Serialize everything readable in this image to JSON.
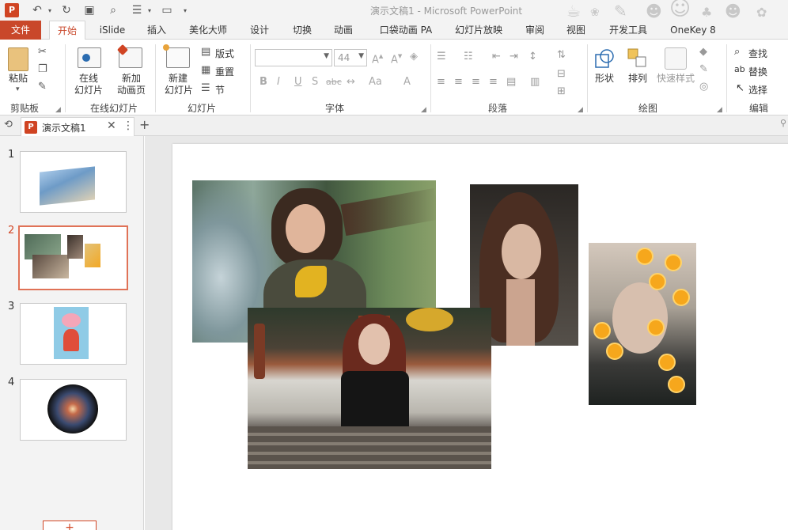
{
  "app": {
    "title": "演示文稿1 - Microsoft PowerPoint",
    "logo_letter": "P"
  },
  "tabs": [
    {
      "label": "文件"
    },
    {
      "label": "开始"
    },
    {
      "label": "iSlide"
    },
    {
      "label": "插入"
    },
    {
      "label": "美化大师"
    },
    {
      "label": "设计"
    },
    {
      "label": "切换"
    },
    {
      "label": "动画"
    },
    {
      "label": "口袋动画 PA"
    },
    {
      "label": "幻灯片放映"
    },
    {
      "label": "审阅"
    },
    {
      "label": "视图"
    },
    {
      "label": "开发工具"
    },
    {
      "label": "OneKey 8"
    }
  ],
  "ribbon": {
    "clipboard": {
      "label": "剪贴板",
      "paste": "粘贴"
    },
    "online_slides": {
      "label": "在线幻灯片",
      "btn1_line1": "在线",
      "btn1_line2": "幻灯片",
      "btn2_line1": "新加",
      "btn2_line2": "动画页"
    },
    "slides": {
      "label": "幻灯片",
      "new_line1": "新建",
      "new_line2": "幻灯片",
      "layout": "版式",
      "reset": "重置",
      "section": "节"
    },
    "font": {
      "label": "字体",
      "font_name": "",
      "font_size": "44"
    },
    "paragraph": {
      "label": "段落"
    },
    "drawing": {
      "label": "绘图",
      "shapes": "形状",
      "arrange": "排列",
      "quick_styles": "快速样式"
    },
    "editing": {
      "label": "编辑",
      "find": "查找",
      "replace": "替换",
      "select": "选择"
    }
  },
  "document": {
    "tab_name": "演示文稿1"
  },
  "thumbnails": [
    {
      "num": "1"
    },
    {
      "num": "2"
    },
    {
      "num": "3"
    },
    {
      "num": "4"
    }
  ],
  "add_slide_label": "+"
}
